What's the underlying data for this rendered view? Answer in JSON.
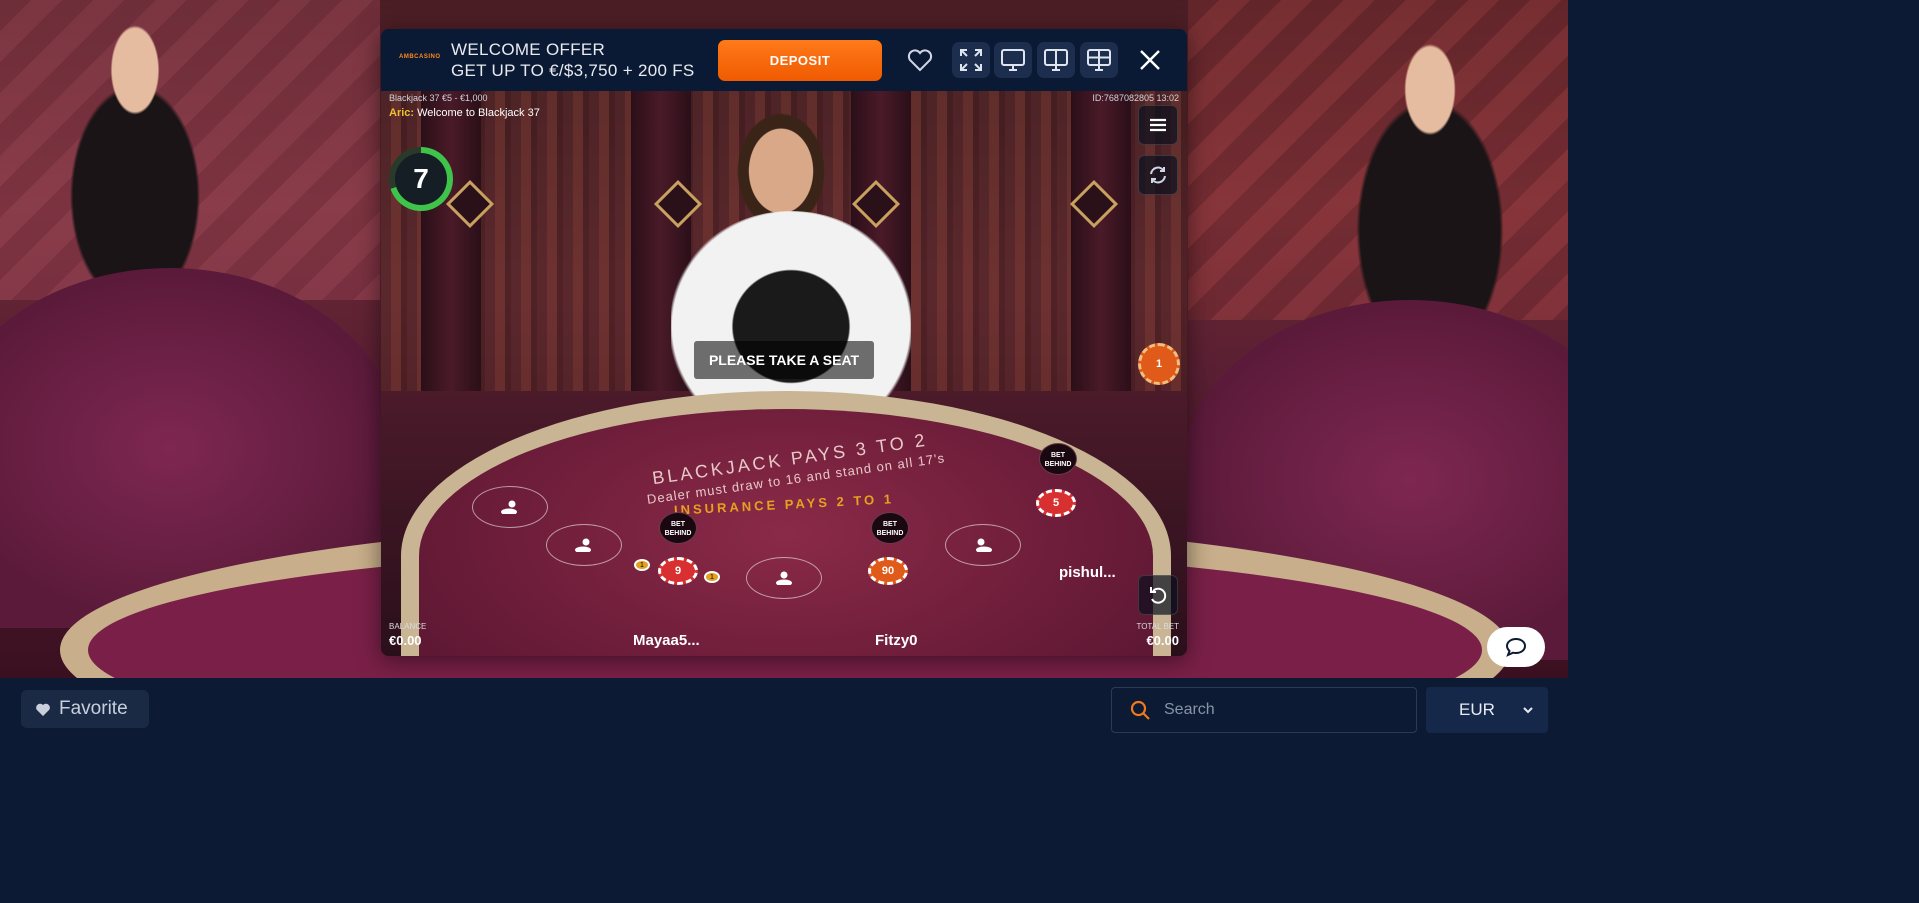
{
  "header": {
    "logo_text": "AMBCASINO",
    "offer_line1": "WELCOME OFFER",
    "offer_line2": "GET UP TO €/$3,750 + 200 FS",
    "deposit_label": "DEPOSIT",
    "icons": [
      "heart-icon",
      "fullscreen-icon",
      "single-view-icon",
      "split-view-icon",
      "grid-view-icon",
      "close-icon"
    ]
  },
  "game": {
    "table_info": "Blackjack 37  €5 - €1,000",
    "round_info": "ID:7687082805  13:02",
    "chat": {
      "author": "Aric:",
      "message": "Welcome to Blackjack 37"
    },
    "timer": "7",
    "prompt": "PLEASE TAKE A SEAT",
    "felt": {
      "line1": "BLACKJACK PAYS 3 TO 2",
      "line2": "Dealer must draw to 16 and stand on all 17's",
      "line3": "INSURANCE PAYS 2 TO 1"
    },
    "bet_behind": "BET BEHIND",
    "chips": {
      "left": "9",
      "center": "90",
      "right": "5",
      "mini_left": "1",
      "mini_right": "1",
      "stack": "1"
    },
    "players": {
      "left": "Mayaa5...",
      "center": "Fitzy0",
      "right": "pishul..."
    },
    "balance_label": "BALANCE",
    "balance_value": "€0.00",
    "total_bet_label": "TOTAL BET",
    "total_bet_value": "€0.00"
  },
  "footer": {
    "favorite_label": "Favorite",
    "search_placeholder": "Search",
    "currency": "EUR"
  },
  "colors": {
    "accent": "#f05a00",
    "navy": "#0c1a33",
    "timer_green": "#3ec44a"
  }
}
